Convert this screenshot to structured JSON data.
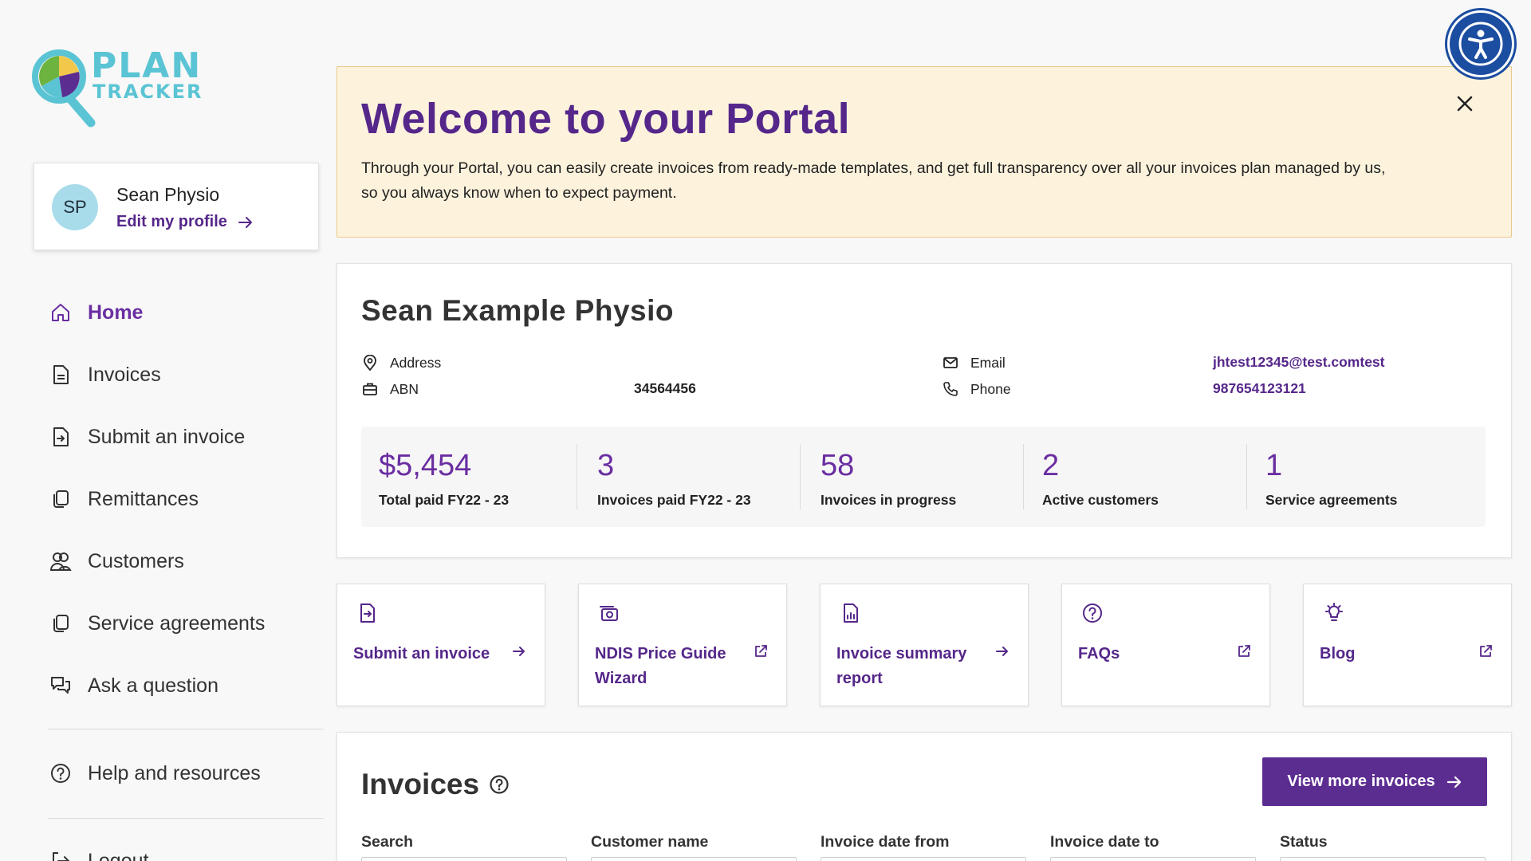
{
  "brand": {
    "plan": "PLAN",
    "tracker": "TRACKER",
    "colors": {
      "teal": "#5bc4d4",
      "purple": "#55278a",
      "yellow": "#f2c84b",
      "green": "#6cb33f"
    }
  },
  "profile": {
    "initials": "SP",
    "name": "Sean Physio",
    "edit_label": "Edit my profile"
  },
  "nav": {
    "home": "Home",
    "invoices": "Invoices",
    "submit_invoice": "Submit an invoice",
    "remittances": "Remittances",
    "customers": "Customers",
    "service_agreements": "Service agreements",
    "ask_question": "Ask a question",
    "help_resources": "Help and resources",
    "logout": "Logout"
  },
  "welcome": {
    "title": "Welcome to your Portal",
    "body": "Through your Portal, you can easily create invoices from ready-made templates, and get full transparency over all your invoices plan managed by us, so you always know when to expect payment."
  },
  "org": {
    "name": "Sean Example Physio",
    "address_label": "Address",
    "address_value": "",
    "abn_label": "ABN",
    "abn_value": "34564456",
    "email_label": "Email",
    "email_value": "jhtest12345@test.comtest",
    "phone_label": "Phone",
    "phone_value": "987654123121"
  },
  "stats": [
    {
      "value": "$5,454",
      "label": "Total paid FY22 - 23"
    },
    {
      "value": "3",
      "label": "Invoices paid FY22 - 23"
    },
    {
      "value": "58",
      "label": "Invoices in progress"
    },
    {
      "value": "2",
      "label": "Active customers"
    },
    {
      "value": "1",
      "label": "Service agreements"
    }
  ],
  "tiles": [
    {
      "label": "Submit an invoice",
      "icon": "file-arrow-icon",
      "arrow": "arrow-right-icon"
    },
    {
      "label": "NDIS Price Guide Wizard",
      "icon": "camera-icon",
      "arrow": "external-link-icon"
    },
    {
      "label": "Invoice summary report",
      "icon": "report-icon",
      "arrow": "arrow-right-icon"
    },
    {
      "label": "FAQs",
      "icon": "question-icon",
      "arrow": "external-link-icon"
    },
    {
      "label": "Blog",
      "icon": "lightbulb-icon",
      "arrow": "external-link-icon"
    }
  ],
  "invoices": {
    "title": "Invoices",
    "view_more": "View more invoices",
    "filters": {
      "search": "Search",
      "customer_name": "Customer name",
      "date_from": "Invoice date from",
      "date_to": "Invoice date to",
      "status": "Status"
    }
  }
}
